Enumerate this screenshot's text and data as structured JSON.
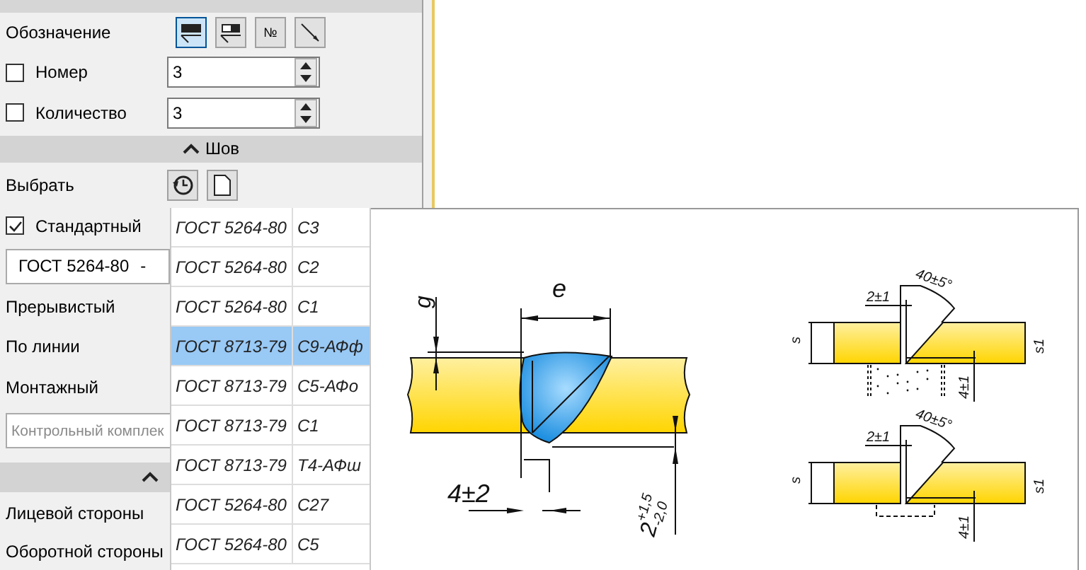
{
  "panel": {
    "designation": {
      "label": "Обозначение",
      "buttons": [
        {
          "kind": "filled",
          "selected": true
        },
        {
          "kind": "partial",
          "selected": false
        },
        {
          "kind": "number",
          "label": "№",
          "selected": false
        },
        {
          "kind": "leader",
          "selected": false
        }
      ]
    },
    "counters": [
      {
        "label": "Номер",
        "checked": false,
        "value": "3"
      },
      {
        "label": "Количество",
        "checked": false,
        "value": "3"
      }
    ],
    "seam_section": {
      "title": "Шов",
      "expanded": true
    },
    "choose": {
      "label": "Выбрать",
      "buttons": [
        {
          "kind": "history"
        },
        {
          "kind": "document"
        }
      ]
    },
    "standard": {
      "label": "Стандартный",
      "checked": true
    },
    "standard_combo": {
      "value": "ГОСТ 5264-80",
      "suffix": "-"
    },
    "options": [
      "Прерывистый",
      "По линии",
      "Монтажный"
    ],
    "control_field": {
      "placeholder": "Контрольный комплек"
    },
    "second_section": {
      "expanded": true
    },
    "sides": [
      "Лицевой стороны",
      "Оборотной стороны"
    ]
  },
  "popup": {
    "rows": [
      {
        "standard": "ГОСТ 5264-80",
        "code": "С3",
        "selected": false
      },
      {
        "standard": "ГОСТ 5264-80",
        "code": "С2",
        "selected": false
      },
      {
        "standard": "ГОСТ 5264-80",
        "code": "С1",
        "selected": false
      },
      {
        "standard": "ГОСТ 8713-79",
        "code": "С9-АФф",
        "selected": true
      },
      {
        "standard": "ГОСТ 8713-79",
        "code": "С5-АФо",
        "selected": false
      },
      {
        "standard": "ГОСТ 8713-79",
        "code": "С1",
        "selected": false
      },
      {
        "standard": "ГОСТ 8713-79",
        "code": "Т4-АФш",
        "selected": false
      },
      {
        "standard": "ГОСТ 5264-80",
        "code": "С27",
        "selected": false
      },
      {
        "standard": "ГОСТ 5264-80",
        "code": "С5",
        "selected": false
      }
    ],
    "preview": {
      "width_label": "e",
      "height_label": "g",
      "gap_label": "4±2",
      "depth": {
        "base": "2",
        "upper": "+1,5",
        "lower": "-2,0"
      },
      "prep": [
        {
          "angle": "40±5°",
          "gap": "2±1",
          "thickness": "s",
          "thickness2": "s1",
          "root": "4±1",
          "kind": "flux"
        },
        {
          "angle": "40±5°",
          "gap": "2±1",
          "thickness": "s",
          "thickness2": "s1",
          "root": "4±1",
          "kind": "plate"
        }
      ]
    }
  }
}
